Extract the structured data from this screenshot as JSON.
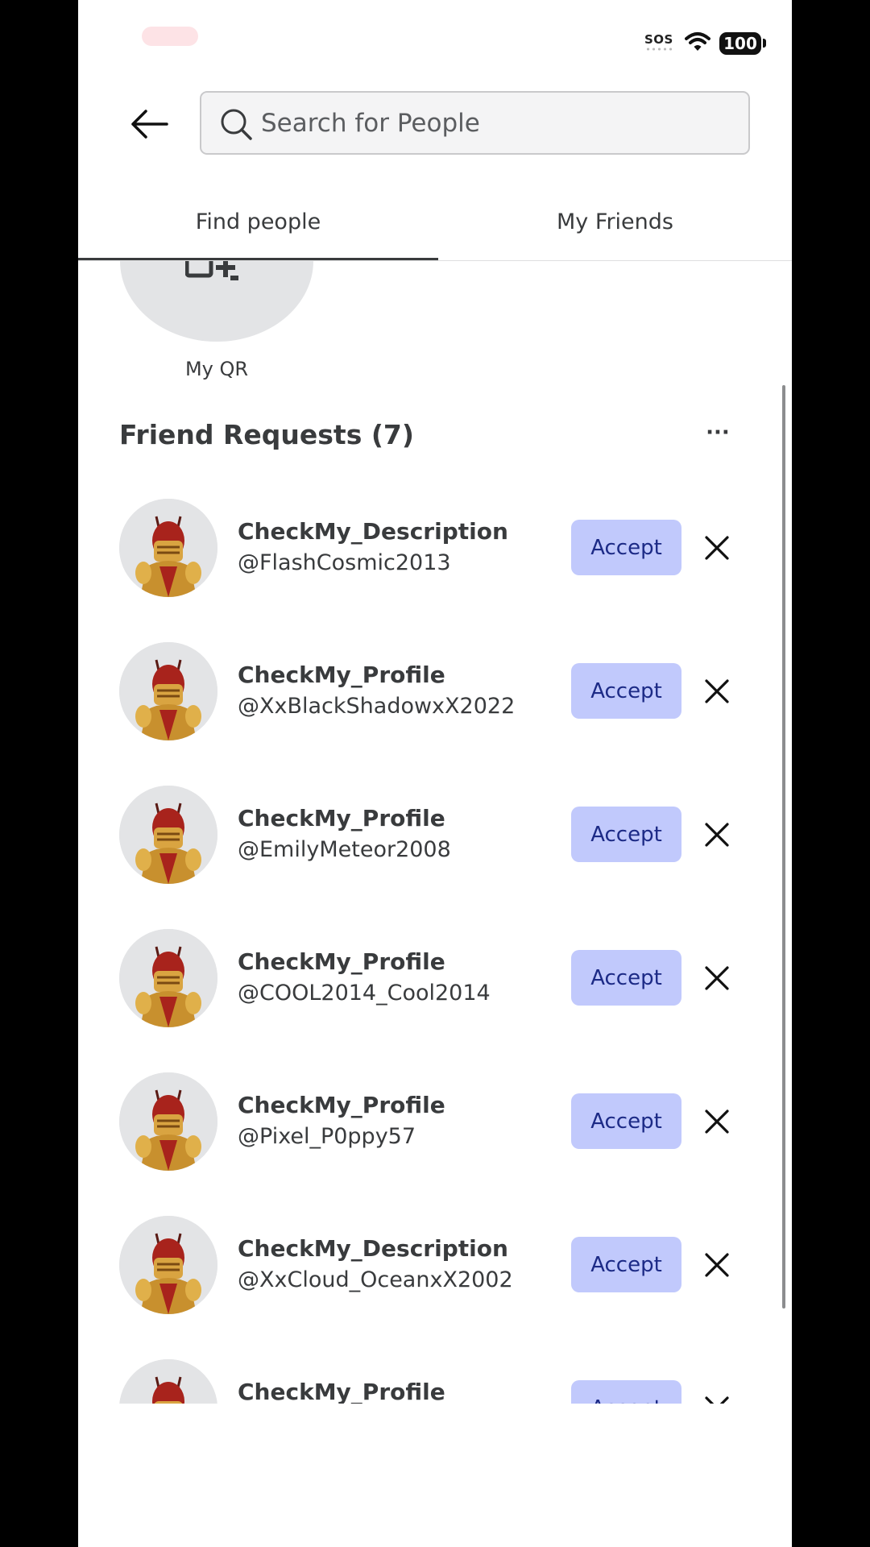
{
  "status_bar": {
    "sos": "SOS",
    "battery": "100"
  },
  "header": {
    "search_placeholder": "Search for People"
  },
  "tabs": [
    {
      "label": "Find people",
      "active": true
    },
    {
      "label": "My Friends",
      "active": false
    }
  ],
  "qr": {
    "label": "My QR"
  },
  "friend_requests": {
    "title": "Friend Requests (7)",
    "accept_label": "Accept",
    "items": [
      {
        "display_name": "CheckMy_Description",
        "username": "@FlashCosmic2013"
      },
      {
        "display_name": "CheckMy_Profile",
        "username": "@XxBlackShadowxX2022"
      },
      {
        "display_name": "CheckMy_Profile",
        "username": "@EmilyMeteor2008"
      },
      {
        "display_name": "CheckMy_Profile",
        "username": "@COOL2014_Cool2014"
      },
      {
        "display_name": "CheckMy_Profile",
        "username": "@Pixel_P0ppy57"
      },
      {
        "display_name": "CheckMy_Description",
        "username": "@XxCloud_OceanxX2002"
      },
      {
        "display_name": "CheckMy_Profile",
        "username": ""
      }
    ]
  },
  "colors": {
    "accept_bg": "#c1c9fc",
    "accept_text": "#1c2a86",
    "text": "#393b3d",
    "avatar_bg": "#e3e4e6"
  },
  "icons": [
    "back-arrow-icon",
    "search-icon",
    "qr-code-icon",
    "more-options-icon",
    "close-icon",
    "wifi-icon",
    "battery-icon"
  ]
}
